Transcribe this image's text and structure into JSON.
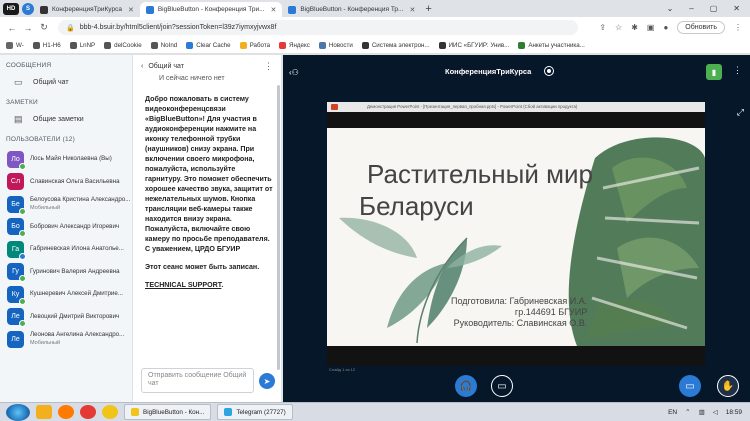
{
  "browser": {
    "tabs": [
      {
        "label": "КонференцияТриКурса",
        "active": false,
        "favicon_color": "#333"
      },
      {
        "label": "BigBlueButton - Конференция Три...",
        "active": true,
        "favicon_color": "#2b7bd6"
      },
      {
        "label": "BigBlueButton - Конференция Тр...",
        "active": false,
        "favicon_color": "#2b7bd6"
      }
    ],
    "left_icons": [
      "HD",
      "S"
    ],
    "url": "bbb-4.bsuir.by/html5client/join?sessionToken=l39z7iymxyjvwx8f",
    "update_label": "Обновить",
    "bookmarks": [
      "W-",
      "H1-H6",
      "LnNP",
      "delCookie",
      "NoInd",
      "Clear Cache",
      "Работа",
      "Яндекс",
      "Новости",
      "Система электрон...",
      "ИИС «БГУИР: Унив...",
      "Анкеты участника..."
    ]
  },
  "sidebar": {
    "messages_title": "СООБЩЕНИЯ",
    "public_chat": "Общий чат",
    "notes_title": "ЗАМЕТКИ",
    "shared_notes": "Общие заметки",
    "users_title": "ПОЛЬЗОВАТЕЛИ (12)",
    "users": [
      {
        "initials": "Ло",
        "name": "Лось Майя Николаевна (Вы)",
        "role": "",
        "color": "#7e57c2",
        "presenter": false
      },
      {
        "initials": "Сл",
        "name": "Славинская Ольга Васильевна",
        "role": "",
        "color": "#c2185b",
        "presenter": false
      },
      {
        "initials": "Бе",
        "name": "Белоусова Кристина Александро...",
        "role": "Мобильный",
        "color": "#1565c0",
        "presenter": false
      },
      {
        "initials": "Бо",
        "name": "Бобрович Александр Игоревич",
        "role": "",
        "color": "#1565c0",
        "presenter": false
      },
      {
        "initials": "Га",
        "name": "Габриневская Илона Анатолье...",
        "role": "",
        "color": "#00897b",
        "presenter": true
      },
      {
        "initials": "Гу",
        "name": "Гуринович Валерия Андреевна",
        "role": "",
        "color": "#1565c0",
        "presenter": false
      },
      {
        "initials": "Ку",
        "name": "Кушнеревич Алексей Дмитрие...",
        "role": "",
        "color": "#1565c0",
        "presenter": false
      },
      {
        "initials": "Ле",
        "name": "Левоцкий Дмитрий Викторович",
        "role": "",
        "color": "#1565c0",
        "presenter": false
      },
      {
        "initials": "Ле",
        "name": "Леонова Ангелина Александро...",
        "role": "Мобильный",
        "color": "#1565c0",
        "presenter": false
      }
    ]
  },
  "chat": {
    "back_label": "Общий чат",
    "notice": "И сейчас ничего нет",
    "welcome": "Добро пожаловать в систему видеоконференцсвязи «BigBlueButton»! Для участия в аудиоконференции нажмите на иконку телефонной трубки (наушников) снизу экрана. При включении своего микрофона, пожалуйста, используйте гарнитуру. Это поможет обеспечить хорошее качество звука, защитит от нежелательных шумов. Кнопка трансляции веб-камеры также находится внизу экрана. Пожалуйста, включайте свою камеру по просьбе преподавателя. С уважением, ЦРДО БГУИР",
    "recording_notice": "Этот сеанс может быть записан.",
    "support_link": "TECHNICAL SUPPORT",
    "support_suffix": ".",
    "input_placeholder": "Отправить сообщение Общий чат"
  },
  "main": {
    "conference_title": "КонференцияТриКурса",
    "ppt_titlebar": "Демонстрация PowerPoint - [Презентация_первая_пробная.pptx] - PowerPoint (Сбой активации продукта)",
    "slide_status": "Слайд 1 из 12",
    "slide": {
      "title_line1": "Растительный мир",
      "title_line2": "Беларуси",
      "prepared_by": "Подготовила: Габриневская И.А.",
      "group": "гр.144691 БГУИР",
      "supervisor": "Руководитель: Славинская О.В."
    }
  },
  "taskbar": {
    "tasks": [
      "BigBlueButton - Кон...",
      "Telegram (27727)"
    ],
    "lang": "EN",
    "time": "18:59"
  },
  "colors": {
    "accent": "#2b7bd6",
    "main_bg": "#06172a",
    "connection": "#4caf50"
  }
}
